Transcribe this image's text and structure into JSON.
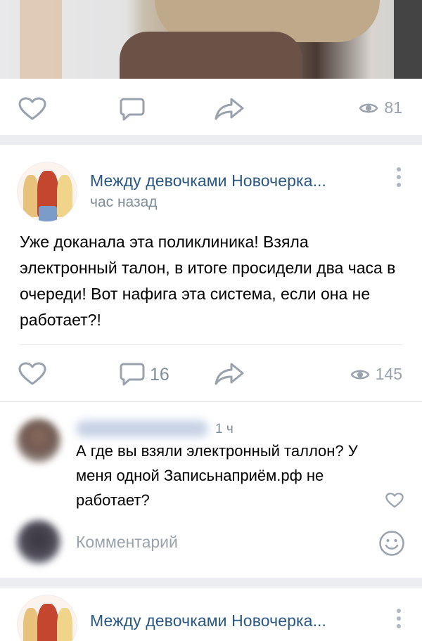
{
  "top_post": {
    "views": "81",
    "photo_alt": ""
  },
  "post": {
    "group_name": "Между девочками Новочерка...",
    "time": "час назад",
    "text": "Уже доканала эта поликлиника! Взяла электронный талон, в итоге просидели два часа в очереди! Вот нафига эта система, если она не работает?!",
    "comments_count": "16",
    "views": "145",
    "icons": [
      "heart-icon",
      "comment-icon",
      "share-icon",
      "eye-icon",
      "more-vertical-icon"
    ]
  },
  "comment": {
    "time": "1 ч",
    "text": "А где вы взяли электронный таллон? У меня одной Записьнаприём.рф не работает?"
  },
  "comment_input": {
    "placeholder": "Комментарий"
  },
  "next_post": {
    "group_name": "Между девочками Новочерка..."
  },
  "colors": {
    "link": "#2a5885",
    "secondary": "#818c99",
    "icon": "#99a2ad",
    "separator": "#ebedf0"
  }
}
